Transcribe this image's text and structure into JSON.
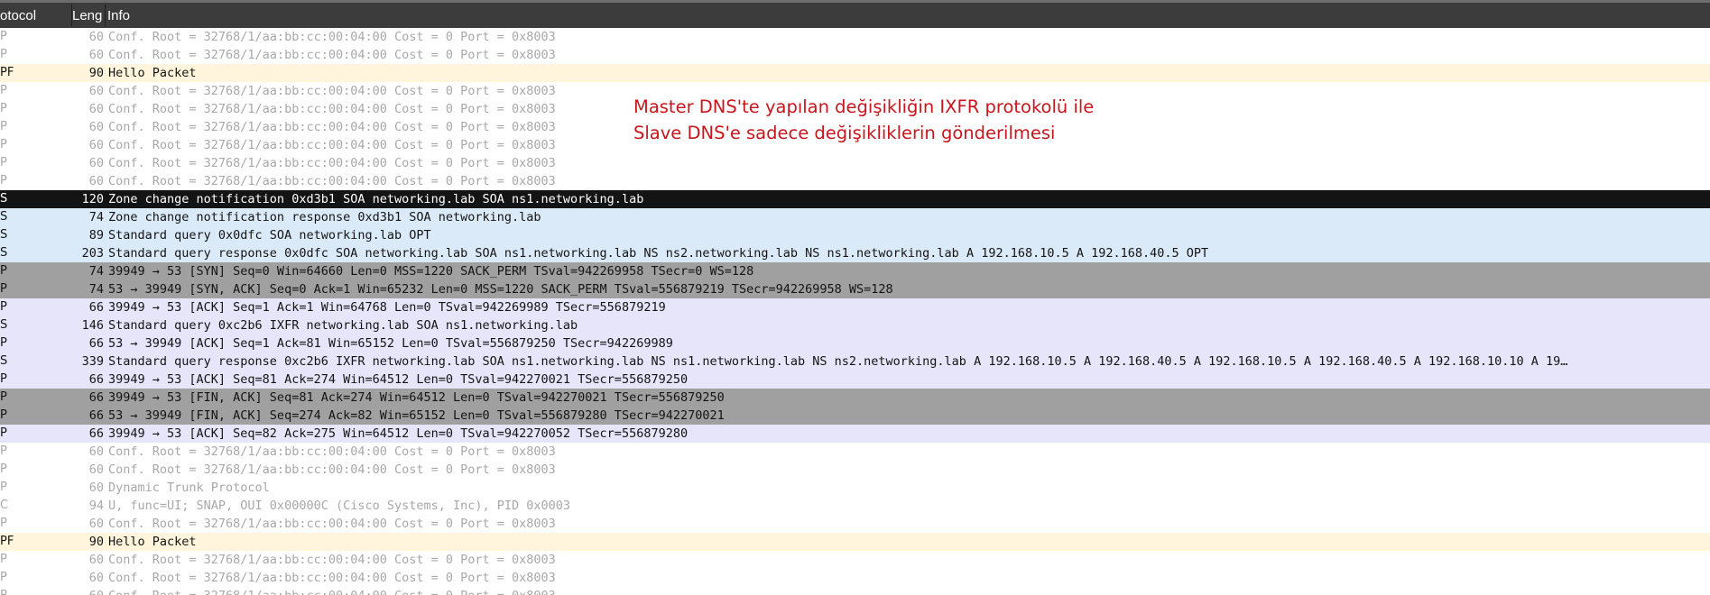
{
  "columns": {
    "protocol": "otocol",
    "length": "Leng",
    "info": "Info"
  },
  "packets": [
    {
      "proto": "P",
      "len": "60",
      "info": "Conf. Root = 32768/1/aa:bb:cc:00:04:00  Cost = 0  Port = 0x8003",
      "style": "stp"
    },
    {
      "proto": "P",
      "len": "60",
      "info": "Conf. Root = 32768/1/aa:bb:cc:00:04:00  Cost = 0  Port = 0x8003",
      "style": "stp"
    },
    {
      "proto": "PF",
      "len": "90",
      "info": "Hello Packet",
      "style": "hello"
    },
    {
      "proto": "P",
      "len": "60",
      "info": "Conf. Root = 32768/1/aa:bb:cc:00:04:00  Cost = 0  Port = 0x8003",
      "style": "stp"
    },
    {
      "proto": "P",
      "len": "60",
      "info": "Conf. Root = 32768/1/aa:bb:cc:00:04:00  Cost = 0  Port = 0x8003",
      "style": "stp"
    },
    {
      "proto": "P",
      "len": "60",
      "info": "Conf. Root = 32768/1/aa:bb:cc:00:04:00  Cost = 0  Port = 0x8003",
      "style": "stp"
    },
    {
      "proto": "P",
      "len": "60",
      "info": "Conf. Root = 32768/1/aa:bb:cc:00:04:00  Cost = 0  Port = 0x8003",
      "style": "stp"
    },
    {
      "proto": "P",
      "len": "60",
      "info": "Conf. Root = 32768/1/aa:bb:cc:00:04:00  Cost = 0  Port = 0x8003",
      "style": "stp"
    },
    {
      "proto": "P",
      "len": "60",
      "info": "Conf. Root = 32768/1/aa:bb:cc:00:04:00  Cost = 0  Port = 0x8003",
      "style": "stp"
    },
    {
      "proto": "S",
      "len": "120",
      "info": "Zone change notification 0xd3b1 SOA networking.lab SOA ns1.networking.lab",
      "style": "notify"
    },
    {
      "proto": "S",
      "len": "74",
      "info": "Zone change notification response 0xd3b1 SOA networking.lab",
      "style": "dns"
    },
    {
      "proto": "S",
      "len": "89",
      "info": "Standard query 0x0dfc SOA networking.lab OPT",
      "style": "dns"
    },
    {
      "proto": "S",
      "len": "203",
      "info": "Standard query response 0x0dfc SOA networking.lab SOA ns1.networking.lab NS ns2.networking.lab NS ns1.networking.lab A 192.168.10.5 A 192.168.40.5 OPT",
      "style": "dns"
    },
    {
      "proto": "P",
      "len": "74",
      "info": "39949 → 53 [SYN] Seq=0 Win=64660 Len=0 MSS=1220 SACK_PERM TSval=942269958 TSecr=0 WS=128",
      "style": "syn"
    },
    {
      "proto": "P",
      "len": "74",
      "info": "53 → 39949 [SYN, ACK] Seq=0 Ack=1 Win=65232 Len=0 MSS=1220 SACK_PERM TSval=556879219 TSecr=942269958 WS=128",
      "style": "syn"
    },
    {
      "proto": "P",
      "len": "66",
      "info": "39949 → 53 [ACK] Seq=1 Ack=1 Win=64768 Len=0 TSval=942269989 TSecr=556879219",
      "style": "tcp"
    },
    {
      "proto": "S",
      "len": "146",
      "info": "Standard query 0xc2b6 IXFR networking.lab SOA ns1.networking.lab",
      "style": "tcp"
    },
    {
      "proto": "P",
      "len": "66",
      "info": "53 → 39949 [ACK] Seq=1 Ack=81 Win=65152 Len=0 TSval=556879250 TSecr=942269989",
      "style": "tcp"
    },
    {
      "proto": "S",
      "len": "339",
      "info": "Standard query response 0xc2b6 IXFR networking.lab SOA ns1.networking.lab NS ns1.networking.lab NS ns2.networking.lab A 192.168.10.5 A 192.168.40.5 A 192.168.10.5 A 192.168.40.5 A 192.168.10.10 A 19…",
      "style": "tcp"
    },
    {
      "proto": "P",
      "len": "66",
      "info": "39949 → 53 [ACK] Seq=81 Ack=274 Win=64512 Len=0 TSval=942270021 TSecr=556879250",
      "style": "tcp"
    },
    {
      "proto": "P",
      "len": "66",
      "info": "39949 → 53 [FIN, ACK] Seq=81 Ack=274 Win=64512 Len=0 TSval=942270021 TSecr=556879250",
      "style": "syn"
    },
    {
      "proto": "P",
      "len": "66",
      "info": "53 → 39949 [FIN, ACK] Seq=274 Ack=82 Win=65152 Len=0 TSval=556879280 TSecr=942270021",
      "style": "syn"
    },
    {
      "proto": "P",
      "len": "66",
      "info": "39949 → 53 [ACK] Seq=82 Ack=275 Win=64512 Len=0 TSval=942270052 TSecr=556879280",
      "style": "tcp"
    },
    {
      "proto": "P",
      "len": "60",
      "info": "Conf. Root = 32768/1/aa:bb:cc:00:04:00  Cost = 0  Port = 0x8003",
      "style": "stp"
    },
    {
      "proto": "P",
      "len": "60",
      "info": "Conf. Root = 32768/1/aa:bb:cc:00:04:00  Cost = 0  Port = 0x8003",
      "style": "stp"
    },
    {
      "proto": "P",
      "len": "60",
      "info": "Dynamic Trunk Protocol",
      "style": "stp"
    },
    {
      "proto": "C",
      "len": "94",
      "info": "U, func=UI; SNAP, OUI 0x00000C (Cisco Systems, Inc), PID 0x0003",
      "style": "stp"
    },
    {
      "proto": "P",
      "len": "60",
      "info": "Conf. Root = 32768/1/aa:bb:cc:00:04:00  Cost = 0  Port = 0x8003",
      "style": "stp"
    },
    {
      "proto": "PF",
      "len": "90",
      "info": "Hello Packet",
      "style": "hello"
    },
    {
      "proto": "P",
      "len": "60",
      "info": "Conf. Root = 32768/1/aa:bb:cc:00:04:00  Cost = 0  Port = 0x8003",
      "style": "stp"
    },
    {
      "proto": "P",
      "len": "60",
      "info": "Conf. Root = 32768/1/aa:bb:cc:00:04:00  Cost = 0  Port = 0x8003",
      "style": "stp"
    },
    {
      "proto": "P",
      "len": "60",
      "info": "Conf. Root = 32768/1/aa:bb:cc:00:04:00  Cost = 0  Port = 0x8003",
      "style": "stp"
    }
  ],
  "annotation": {
    "line1": "Master DNS'te yapılan değişikliğin IXFR protokolü ile",
    "line2": "Slave DNS'e sadece değişikliklerin gönderilmesi"
  },
  "colors": {
    "header_bg": "#3c3c3c",
    "stp_text": "#a8a8a8",
    "hello_bg": "#fff5dc",
    "notify_bg": "#141414",
    "dns_bg": "#dbeaf9",
    "syn_bg": "#a0a0a0",
    "tcp_bg": "#e6e5fa",
    "annotation_text": "#c8161d"
  }
}
